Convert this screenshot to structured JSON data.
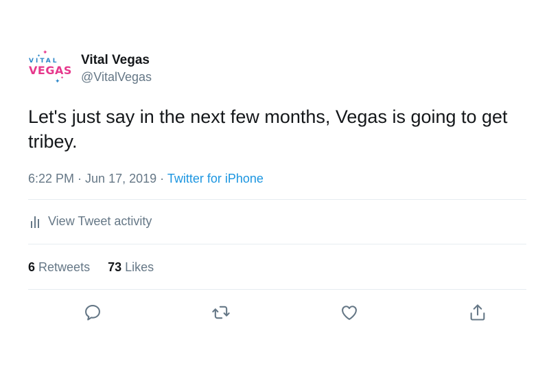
{
  "user": {
    "display_name": "Vital Vegas",
    "handle": "@VitalVegas",
    "avatar": {
      "logo_top": "VITAL",
      "logo_main": "VEGAS",
      "colors": {
        "pink": "#e6388c",
        "blue": "#2a86c8"
      }
    }
  },
  "tweet": {
    "text": "Let's just say in the next few months, Vegas is going to get tribey.",
    "time": "6:22 PM",
    "separator": " · ",
    "date": "Jun 17, 2019",
    "source": "Twitter for iPhone"
  },
  "activity": {
    "label": "View Tweet activity",
    "icon": "bar-chart-icon"
  },
  "stats": {
    "retweets_count": "6",
    "retweets_label": "Retweets",
    "likes_count": "73",
    "likes_label": "Likes"
  },
  "actions": [
    {
      "name": "reply",
      "icon": "reply-icon"
    },
    {
      "name": "retweet",
      "icon": "retweet-icon"
    },
    {
      "name": "like",
      "icon": "heart-icon"
    },
    {
      "name": "share",
      "icon": "share-icon"
    }
  ],
  "colors": {
    "text": "#14171a",
    "secondary": "#657786",
    "link": "#1b95e0",
    "divider": "#e6ecf0"
  }
}
